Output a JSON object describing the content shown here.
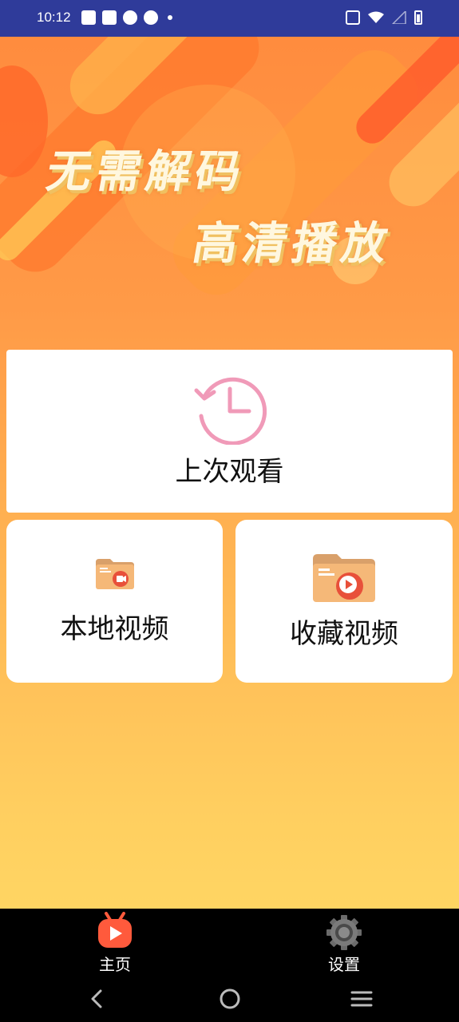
{
  "status_bar": {
    "time": "10:12"
  },
  "banner": {
    "slogan_line1": "无需解码",
    "slogan_line2": "高清播放"
  },
  "cards": {
    "last_watched": {
      "label": "上次观看",
      "icon": "history-clock-icon"
    },
    "local_videos": {
      "label": "本地视频",
      "icon": "video-folder-icon"
    },
    "favorite_videos": {
      "label": "收藏视频",
      "icon": "play-folder-icon"
    }
  },
  "tabbar": {
    "items": [
      {
        "label": "主页",
        "icon": "tv-play-icon",
        "active": true
      },
      {
        "label": "设置",
        "icon": "gear-icon",
        "active": false
      }
    ]
  },
  "colors": {
    "status_bar": "#2f3b9a",
    "accent": "#ff5a3c",
    "clock_pink": "#f09ab8",
    "folder": "#f5b878"
  }
}
